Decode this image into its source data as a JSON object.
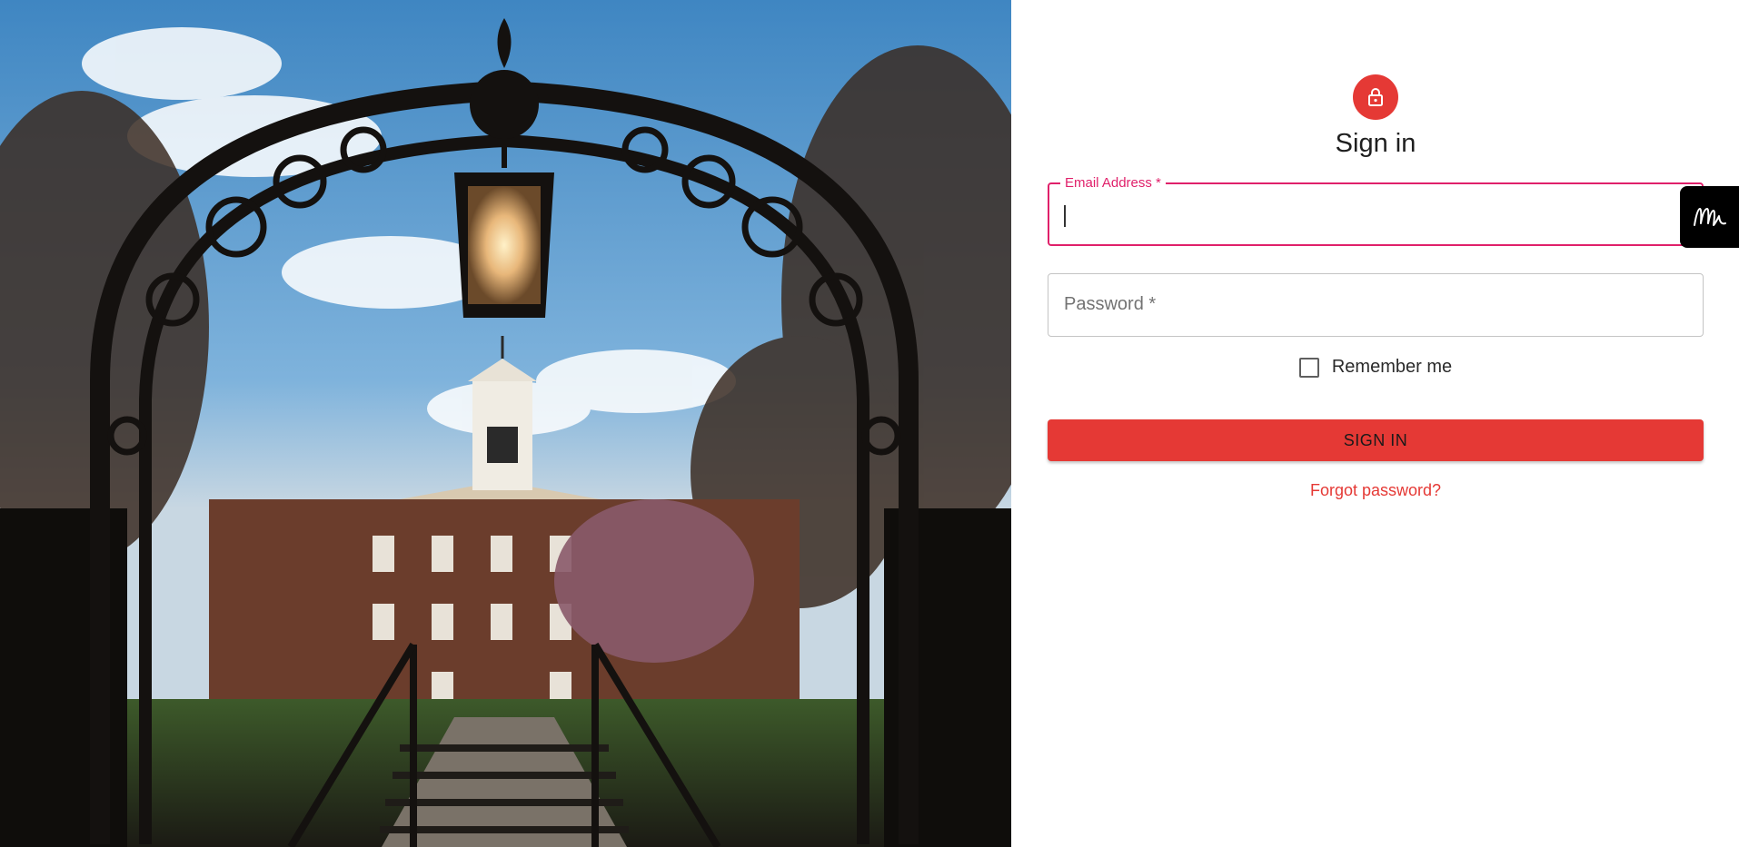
{
  "page": {
    "title": "Sign in"
  },
  "hero": {
    "image": "campus-gate-photo"
  },
  "form": {
    "email": {
      "label": "Email Address *",
      "value": ""
    },
    "password": {
      "label": "Password *",
      "value": ""
    },
    "remember_label": "Remember me",
    "remember_checked": false,
    "submit_label": "SIGN IN",
    "forgot_label": "Forgot password?"
  },
  "widget": {
    "icon": "signature-icon"
  },
  "colors": {
    "accent": "#e53935",
    "focus": "#e0206a"
  }
}
